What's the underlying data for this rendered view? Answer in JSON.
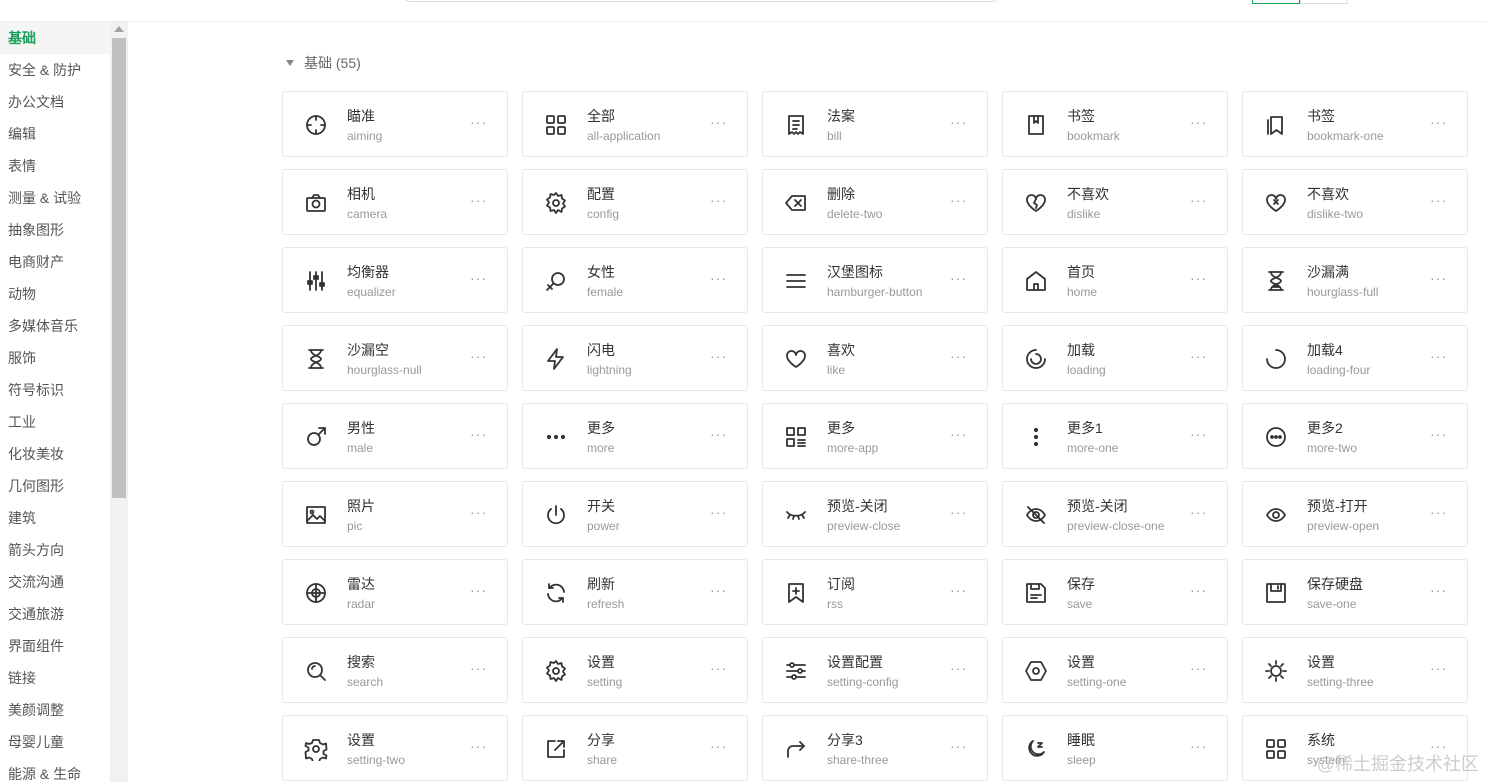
{
  "sidebar": {
    "items": [
      {
        "label": "基础",
        "active": true
      },
      {
        "label": "安全 & 防护"
      },
      {
        "label": "办公文档"
      },
      {
        "label": "编辑"
      },
      {
        "label": "表情"
      },
      {
        "label": "测量 & 试验"
      },
      {
        "label": "抽象图形"
      },
      {
        "label": "电商财产"
      },
      {
        "label": "动物"
      },
      {
        "label": "多媒体音乐"
      },
      {
        "label": "服饰"
      },
      {
        "label": "符号标识"
      },
      {
        "label": "工业"
      },
      {
        "label": "化妆美妆"
      },
      {
        "label": "几何图形"
      },
      {
        "label": "建筑"
      },
      {
        "label": "箭头方向"
      },
      {
        "label": "交流沟通"
      },
      {
        "label": "交通旅游"
      },
      {
        "label": "界面组件"
      },
      {
        "label": "链接"
      },
      {
        "label": "美颜调整"
      },
      {
        "label": "母婴儿童"
      },
      {
        "label": "能源 & 生命"
      }
    ]
  },
  "section": {
    "title": "基础 (55)"
  },
  "more_label": "···",
  "icons": [
    {
      "title": "瞄准",
      "name": "aiming",
      "icon": "aiming-icon"
    },
    {
      "title": "全部",
      "name": "all-application",
      "icon": "all-application-icon"
    },
    {
      "title": "法案",
      "name": "bill",
      "icon": "bill-icon"
    },
    {
      "title": "书签",
      "name": "bookmark",
      "icon": "bookmark-icon"
    },
    {
      "title": "书签",
      "name": "bookmark-one",
      "icon": "bookmark-one-icon"
    },
    {
      "title": "相机",
      "name": "camera",
      "icon": "camera-icon"
    },
    {
      "title": "配置",
      "name": "config",
      "icon": "config-icon"
    },
    {
      "title": "删除",
      "name": "delete-two",
      "icon": "delete-two-icon"
    },
    {
      "title": "不喜欢",
      "name": "dislike",
      "icon": "dislike-icon"
    },
    {
      "title": "不喜欢",
      "name": "dislike-two",
      "icon": "dislike-two-icon"
    },
    {
      "title": "均衡器",
      "name": "equalizer",
      "icon": "equalizer-icon"
    },
    {
      "title": "女性",
      "name": "female",
      "icon": "female-icon"
    },
    {
      "title": "汉堡图标",
      "name": "hamburger-button",
      "icon": "hamburger-button-icon"
    },
    {
      "title": "首页",
      "name": "home",
      "icon": "home-icon"
    },
    {
      "title": "沙漏满",
      "name": "hourglass-full",
      "icon": "hourglass-full-icon"
    },
    {
      "title": "沙漏空",
      "name": "hourglass-null",
      "icon": "hourglass-null-icon"
    },
    {
      "title": "闪电",
      "name": "lightning",
      "icon": "lightning-icon"
    },
    {
      "title": "喜欢",
      "name": "like",
      "icon": "like-icon"
    },
    {
      "title": "加载",
      "name": "loading",
      "icon": "loading-icon"
    },
    {
      "title": "加载4",
      "name": "loading-four",
      "icon": "loading-four-icon"
    },
    {
      "title": "男性",
      "name": "male",
      "icon": "male-icon"
    },
    {
      "title": "更多",
      "name": "more",
      "icon": "more-icon"
    },
    {
      "title": "更多",
      "name": "more-app",
      "icon": "more-app-icon"
    },
    {
      "title": "更多1",
      "name": "more-one",
      "icon": "more-one-icon"
    },
    {
      "title": "更多2",
      "name": "more-two",
      "icon": "more-two-icon"
    },
    {
      "title": "照片",
      "name": "pic",
      "icon": "pic-icon"
    },
    {
      "title": "开关",
      "name": "power",
      "icon": "power-icon"
    },
    {
      "title": "预览-关闭",
      "name": "preview-close",
      "icon": "preview-close-icon"
    },
    {
      "title": "预览-关闭",
      "name": "preview-close-one",
      "icon": "preview-close-one-icon"
    },
    {
      "title": "预览-打开",
      "name": "preview-open",
      "icon": "preview-open-icon"
    },
    {
      "title": "雷达",
      "name": "radar",
      "icon": "radar-icon"
    },
    {
      "title": "刷新",
      "name": "refresh",
      "icon": "refresh-icon"
    },
    {
      "title": "订阅",
      "name": "rss",
      "icon": "rss-icon"
    },
    {
      "title": "保存",
      "name": "save",
      "icon": "save-icon"
    },
    {
      "title": "保存硬盘",
      "name": "save-one",
      "icon": "save-one-icon"
    },
    {
      "title": "搜索",
      "name": "search",
      "icon": "search-icon"
    },
    {
      "title": "设置",
      "name": "setting",
      "icon": "setting-icon"
    },
    {
      "title": "设置配置",
      "name": "setting-config",
      "icon": "setting-config-icon"
    },
    {
      "title": "设置",
      "name": "setting-one",
      "icon": "setting-one-icon"
    },
    {
      "title": "设置",
      "name": "setting-three",
      "icon": "setting-three-icon"
    },
    {
      "title": "设置",
      "name": "setting-two",
      "icon": "setting-two-icon"
    },
    {
      "title": "分享",
      "name": "share",
      "icon": "share-icon"
    },
    {
      "title": "分享3",
      "name": "share-three",
      "icon": "share-three-icon"
    },
    {
      "title": "睡眠",
      "name": "sleep",
      "icon": "sleep-icon"
    },
    {
      "title": "系统",
      "name": "system",
      "icon": "system-icon"
    }
  ],
  "watermark": "@稀土掘金技术社区",
  "colors": {
    "accent": "#18a058",
    "border": "#e8e8e8",
    "muted": "#999999"
  }
}
